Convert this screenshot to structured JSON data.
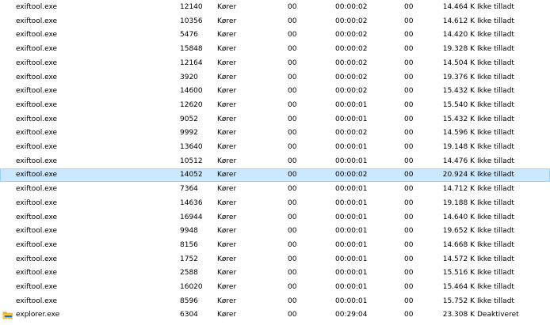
{
  "rows": [
    {
      "name": "exiftool.exe",
      "pid": "12140",
      "status": "Kører",
      "user": "00",
      "cpu_time": "00:00:02",
      "cores": "00",
      "memory": "14.464 K",
      "uac": "Ikke tilladt"
    },
    {
      "name": "exiftool.exe",
      "pid": "10356",
      "status": "Kører",
      "user": "00",
      "cpu_time": "00:00:02",
      "cores": "00",
      "memory": "14.612 K",
      "uac": "Ikke tilladt"
    },
    {
      "name": "exiftool.exe",
      "pid": "5476",
      "status": "Kører",
      "user": "00",
      "cpu_time": "00:00:02",
      "cores": "00",
      "memory": "14.420 K",
      "uac": "Ikke tilladt"
    },
    {
      "name": "exiftool.exe",
      "pid": "15848",
      "status": "Kører",
      "user": "00",
      "cpu_time": "00:00:02",
      "cores": "00",
      "memory": "19.328 K",
      "uac": "Ikke tilladt"
    },
    {
      "name": "exiftool.exe",
      "pid": "12164",
      "status": "Kører",
      "user": "00",
      "cpu_time": "00:00:02",
      "cores": "00",
      "memory": "14.504 K",
      "uac": "Ikke tilladt"
    },
    {
      "name": "exiftool.exe",
      "pid": "3920",
      "status": "Kører",
      "user": "00",
      "cpu_time": "00:00:02",
      "cores": "00",
      "memory": "19.376 K",
      "uac": "Ikke tilladt"
    },
    {
      "name": "exiftool.exe",
      "pid": "14600",
      "status": "Kører",
      "user": "00",
      "cpu_time": "00:00:02",
      "cores": "00",
      "memory": "15.432 K",
      "uac": "Ikke tilladt"
    },
    {
      "name": "exiftool.exe",
      "pid": "12620",
      "status": "Kører",
      "user": "00",
      "cpu_time": "00:00:01",
      "cores": "00",
      "memory": "15.540 K",
      "uac": "Ikke tilladt"
    },
    {
      "name": "exiftool.exe",
      "pid": "9052",
      "status": "Kører",
      "user": "00",
      "cpu_time": "00:00:01",
      "cores": "00",
      "memory": "15.432 K",
      "uac": "Ikke tilladt"
    },
    {
      "name": "exiftool.exe",
      "pid": "9992",
      "status": "Kører",
      "user": "00",
      "cpu_time": "00:00:02",
      "cores": "00",
      "memory": "14.596 K",
      "uac": "Ikke tilladt"
    },
    {
      "name": "exiftool.exe",
      "pid": "13640",
      "status": "Kører",
      "user": "00",
      "cpu_time": "00:00:01",
      "cores": "00",
      "memory": "19.148 K",
      "uac": "Ikke tilladt"
    },
    {
      "name": "exiftool.exe",
      "pid": "10512",
      "status": "Kører",
      "user": "00",
      "cpu_time": "00:00:01",
      "cores": "00",
      "memory": "14.476 K",
      "uac": "Ikke tilladt"
    },
    {
      "name": "exiftool.exe",
      "pid": "14052",
      "status": "Kører",
      "user": "00",
      "cpu_time": "00:00:02",
      "cores": "00",
      "memory": "20.924 K",
      "uac": "Ikke tilladt",
      "selected": true
    },
    {
      "name": "exiftool.exe",
      "pid": "7364",
      "status": "Kører",
      "user": "00",
      "cpu_time": "00:00:01",
      "cores": "00",
      "memory": "14.712 K",
      "uac": "Ikke tilladt"
    },
    {
      "name": "exiftool.exe",
      "pid": "14636",
      "status": "Kører",
      "user": "00",
      "cpu_time": "00:00:01",
      "cores": "00",
      "memory": "19.188 K",
      "uac": "Ikke tilladt"
    },
    {
      "name": "exiftool.exe",
      "pid": "16944",
      "status": "Kører",
      "user": "00",
      "cpu_time": "00:00:01",
      "cores": "00",
      "memory": "14.640 K",
      "uac": "Ikke tilladt"
    },
    {
      "name": "exiftool.exe",
      "pid": "9948",
      "status": "Kører",
      "user": "00",
      "cpu_time": "00:00:01",
      "cores": "00",
      "memory": "19.652 K",
      "uac": "Ikke tilladt"
    },
    {
      "name": "exiftool.exe",
      "pid": "8156",
      "status": "Kører",
      "user": "00",
      "cpu_time": "00:00:01",
      "cores": "00",
      "memory": "14.668 K",
      "uac": "Ikke tilladt"
    },
    {
      "name": "exiftool.exe",
      "pid": "1752",
      "status": "Kører",
      "user": "00",
      "cpu_time": "00:00:01",
      "cores": "00",
      "memory": "14.572 K",
      "uac": "Ikke tilladt"
    },
    {
      "name": "exiftool.exe",
      "pid": "2588",
      "status": "Kører",
      "user": "00",
      "cpu_time": "00:00:01",
      "cores": "00",
      "memory": "15.516 K",
      "uac": "Ikke tilladt"
    },
    {
      "name": "exiftool.exe",
      "pid": "16020",
      "status": "Kører",
      "user": "00",
      "cpu_time": "00:00:01",
      "cores": "00",
      "memory": "15.464 K",
      "uac": "Ikke tilladt"
    },
    {
      "name": "exiftool.exe",
      "pid": "8596",
      "status": "Kører",
      "user": "00",
      "cpu_time": "00:00:01",
      "cores": "00",
      "memory": "15.752 K",
      "uac": "Ikke tilladt"
    },
    {
      "name": "explorer.exe",
      "pid": "6304",
      "status": "Kører",
      "user": "00",
      "cpu_time": "00:29:04",
      "cores": "00",
      "memory": "23.308 K",
      "uac": "Deaktiveret",
      "icon": "folder-icon"
    }
  ],
  "colors": {
    "selected_background": "#cce8ff",
    "selected_border": "#99d1ff",
    "folder_yellow": "#f6c445",
    "folder_dark": "#dcaa2e",
    "folder_blue": "#1f6fd1"
  }
}
